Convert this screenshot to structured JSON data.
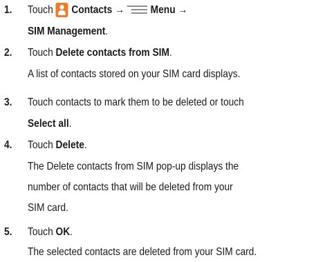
{
  "steps": [
    {
      "number": "1.",
      "lines": [
        {
          "before": "Touch",
          "icon": "contacts-icon",
          "bold": "Contacts →",
          "icon2": "menu-icon",
          "bold2": "Menu →"
        },
        {
          "bold": "SIM Management",
          "after": "."
        }
      ]
    },
    {
      "number": "2.",
      "lines": [
        {
          "before": "Touch ",
          "bold": "Delete contacts from SIM",
          "after": "."
        },
        {
          "text": "A list of contacts stored on your SIM card displays."
        }
      ]
    },
    {
      "number": "3.",
      "lines": [
        {
          "text": "Touch contacts to mark them to be deleted or touch"
        },
        {
          "bold": "Select all",
          "after": "."
        }
      ]
    },
    {
      "number": "4.",
      "lines": [
        {
          "before": "Touch ",
          "bold": "Delete",
          "after": "."
        },
        {
          "text": "The Delete contacts from SIM pop-up displays the"
        },
        {
          "text": "number of contacts that will be deleted from your"
        },
        {
          "text": "SIM card."
        }
      ]
    },
    {
      "number": "5.",
      "lines": [
        {
          "before": "Touch ",
          "bold": "OK",
          "after": "."
        },
        {
          "text": "The selected contacts are deleted from your SIM card."
        }
      ]
    }
  ]
}
